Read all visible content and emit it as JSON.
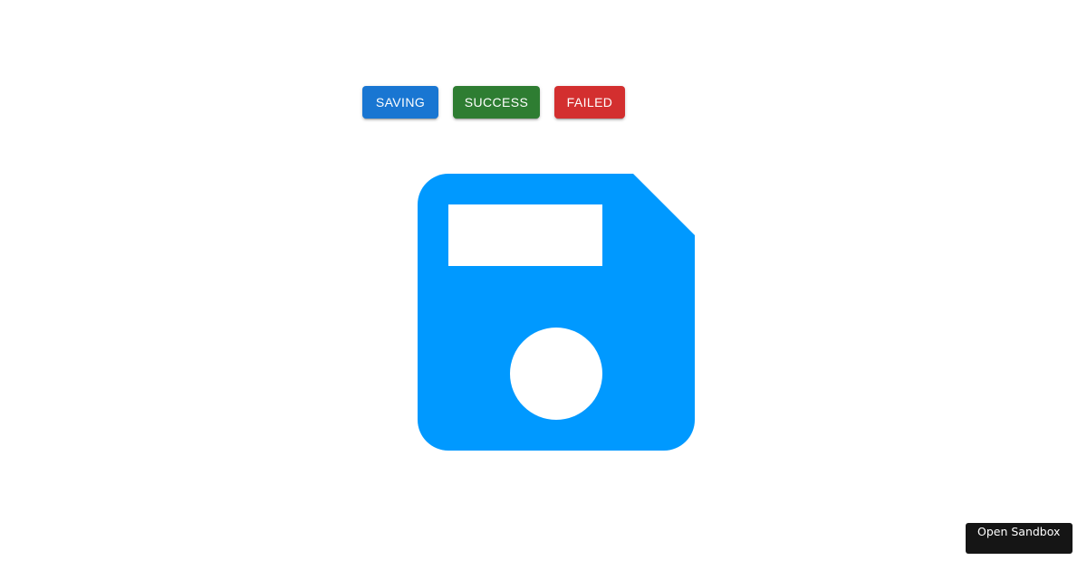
{
  "toolbar": {
    "buttons": [
      {
        "label": "Saving",
        "color": "#1976d2"
      },
      {
        "label": "Success",
        "color": "#2e7d32"
      },
      {
        "label": "Failed",
        "color": "#d32f2f"
      }
    ]
  },
  "icon": {
    "name": "save-icon",
    "color": "#0099ff"
  },
  "footer": {
    "open_sandbox_label": "Open Sandbox"
  }
}
